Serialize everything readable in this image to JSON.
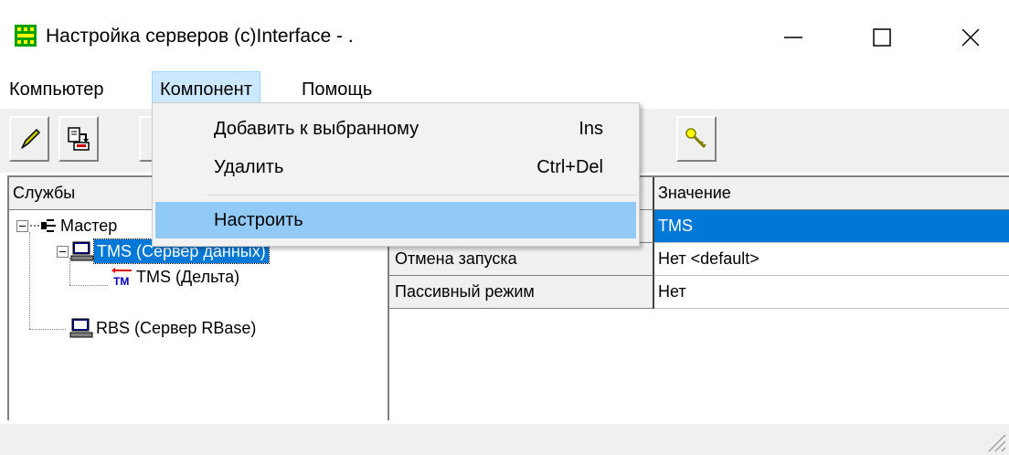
{
  "window": {
    "title": "Настройка серверов (c)Interface - .",
    "icon": "app-grid-icon"
  },
  "menubar": {
    "items": [
      "Компьютер",
      "Компонент",
      "Помощь"
    ],
    "active_index": 1
  },
  "dropdown": {
    "items": [
      {
        "label": "Добавить к выбранному",
        "shortcut": "Ins"
      },
      {
        "label": "Удалить",
        "shortcut": "Ctrl+Del"
      },
      {
        "label": "Настроить",
        "shortcut": ""
      }
    ],
    "highlighted_index": 2
  },
  "toolbar": {
    "buttons": [
      "pencil-icon",
      "copy-icon",
      "key-icon"
    ]
  },
  "tree": {
    "header": "Службы",
    "nodes": [
      {
        "label": "Мастер",
        "icon": "network-icon",
        "level": 0,
        "expanded": true
      },
      {
        "label": "TMS (Сервер данных)",
        "icon": "computer-icon",
        "level": 1,
        "expanded": true,
        "selected": true
      },
      {
        "label": "TMS (Дельта)",
        "icon": "tm-icon",
        "level": 2
      },
      {
        "label": "RBS (Сервер RBase)",
        "icon": "computer-icon",
        "level": 1
      }
    ]
  },
  "grid": {
    "header_value": "Значение",
    "rows": [
      {
        "name": "",
        "value": "TMS",
        "selected": true
      },
      {
        "name": "Отмена запуска",
        "value": "Нет <default>"
      },
      {
        "name": "Пассивный режим",
        "value": "Нет"
      }
    ]
  },
  "colors": {
    "selection": "#0078d7",
    "menu_highlight": "#91c9f7",
    "menu_active": "#cce8ff"
  }
}
